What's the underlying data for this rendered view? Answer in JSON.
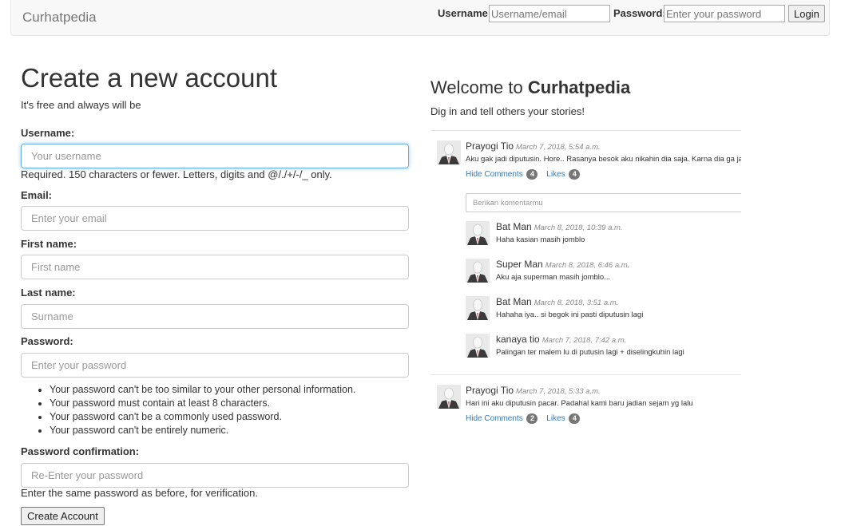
{
  "navbar": {
    "brand": "Curhatpedia",
    "username_label": "Username:",
    "username_placeholder": "Username/email",
    "password_label": "Password:",
    "password_placeholder": "Enter your password",
    "login_label": "Login"
  },
  "signup": {
    "title": "Create a new account",
    "tagline": "It's free and always will be",
    "username_label": "Username:",
    "username_placeholder": "Your username",
    "username_help": "Required. 150 characters or fewer. Letters, digits and @/./+/-/_ only.",
    "email_label": "Email:",
    "email_placeholder": "Enter your email",
    "first_name_label": "First name:",
    "first_name_placeholder": "First name",
    "last_name_label": "Last name:",
    "last_name_placeholder": "Surname",
    "password_label": "Password:",
    "password_placeholder": "Enter your password",
    "password_rules": [
      "Your password can't be too similar to your other personal information.",
      "Your password must contain at least 8 characters.",
      "Your password can't be a commonly used password.",
      "Your password can't be entirely numeric."
    ],
    "confirm_label": "Password confirmation:",
    "confirm_placeholder": "Re-Enter your password",
    "confirm_help": "Enter the same password as before, for verification.",
    "submit_label": "Create Account"
  },
  "welcome": {
    "title_prefix": "Welcome to ",
    "title_brand": "Curhatpedia",
    "subtitle": "Dig in and tell others your stories!"
  },
  "feed": {
    "posts": [
      {
        "author": "Prayogi Tio",
        "date": "March 7, 2018, 5:54 a.m.",
        "text": "Aku gak jadi diputusin. Hore.. Rasanya besok aku nikahin dia saja. Karna dia ga ja",
        "hide_comments": "Hide Comments",
        "comments_count": "4",
        "likes": "Likes",
        "likes_count": "4",
        "comment_placeholder": "Berikan komentarmu",
        "comments": [
          {
            "author": "Bat Man",
            "date": "March 8, 2018, 10:39 a.m.",
            "text": "Haha kasian masih jomblo"
          },
          {
            "author": "Super Man",
            "date": "March 8, 2018, 6:46 a.m.",
            "text": "Aku aja superman masih jomblo..."
          },
          {
            "author": "Bat Man",
            "date": "March 8, 2018, 3:51 a.m.",
            "text": "Hahaha iya.. si begok ini pasti diputusin lagi"
          },
          {
            "author": "kanaya tio",
            "date": "March 7, 2018, 7:42 a.m.",
            "text": "Palingan ter malem lu di putusin lagi + diselingkuhin lagi"
          }
        ]
      },
      {
        "author": "Prayogi Tio",
        "date": "March 7, 2018, 5:33 a.m.",
        "text": "Hari ini aku diputusin pacar. Padahal kami baru jadian sejam yg lalu",
        "hide_comments": "Hide Comments",
        "comments_count": "2",
        "likes": "Likes",
        "likes_count": "4"
      }
    ]
  },
  "colors": {
    "link": "#337ab7",
    "badge": "#777777",
    "focus_border": "#66afe9",
    "navbar_bg": "#f8f8f8"
  }
}
